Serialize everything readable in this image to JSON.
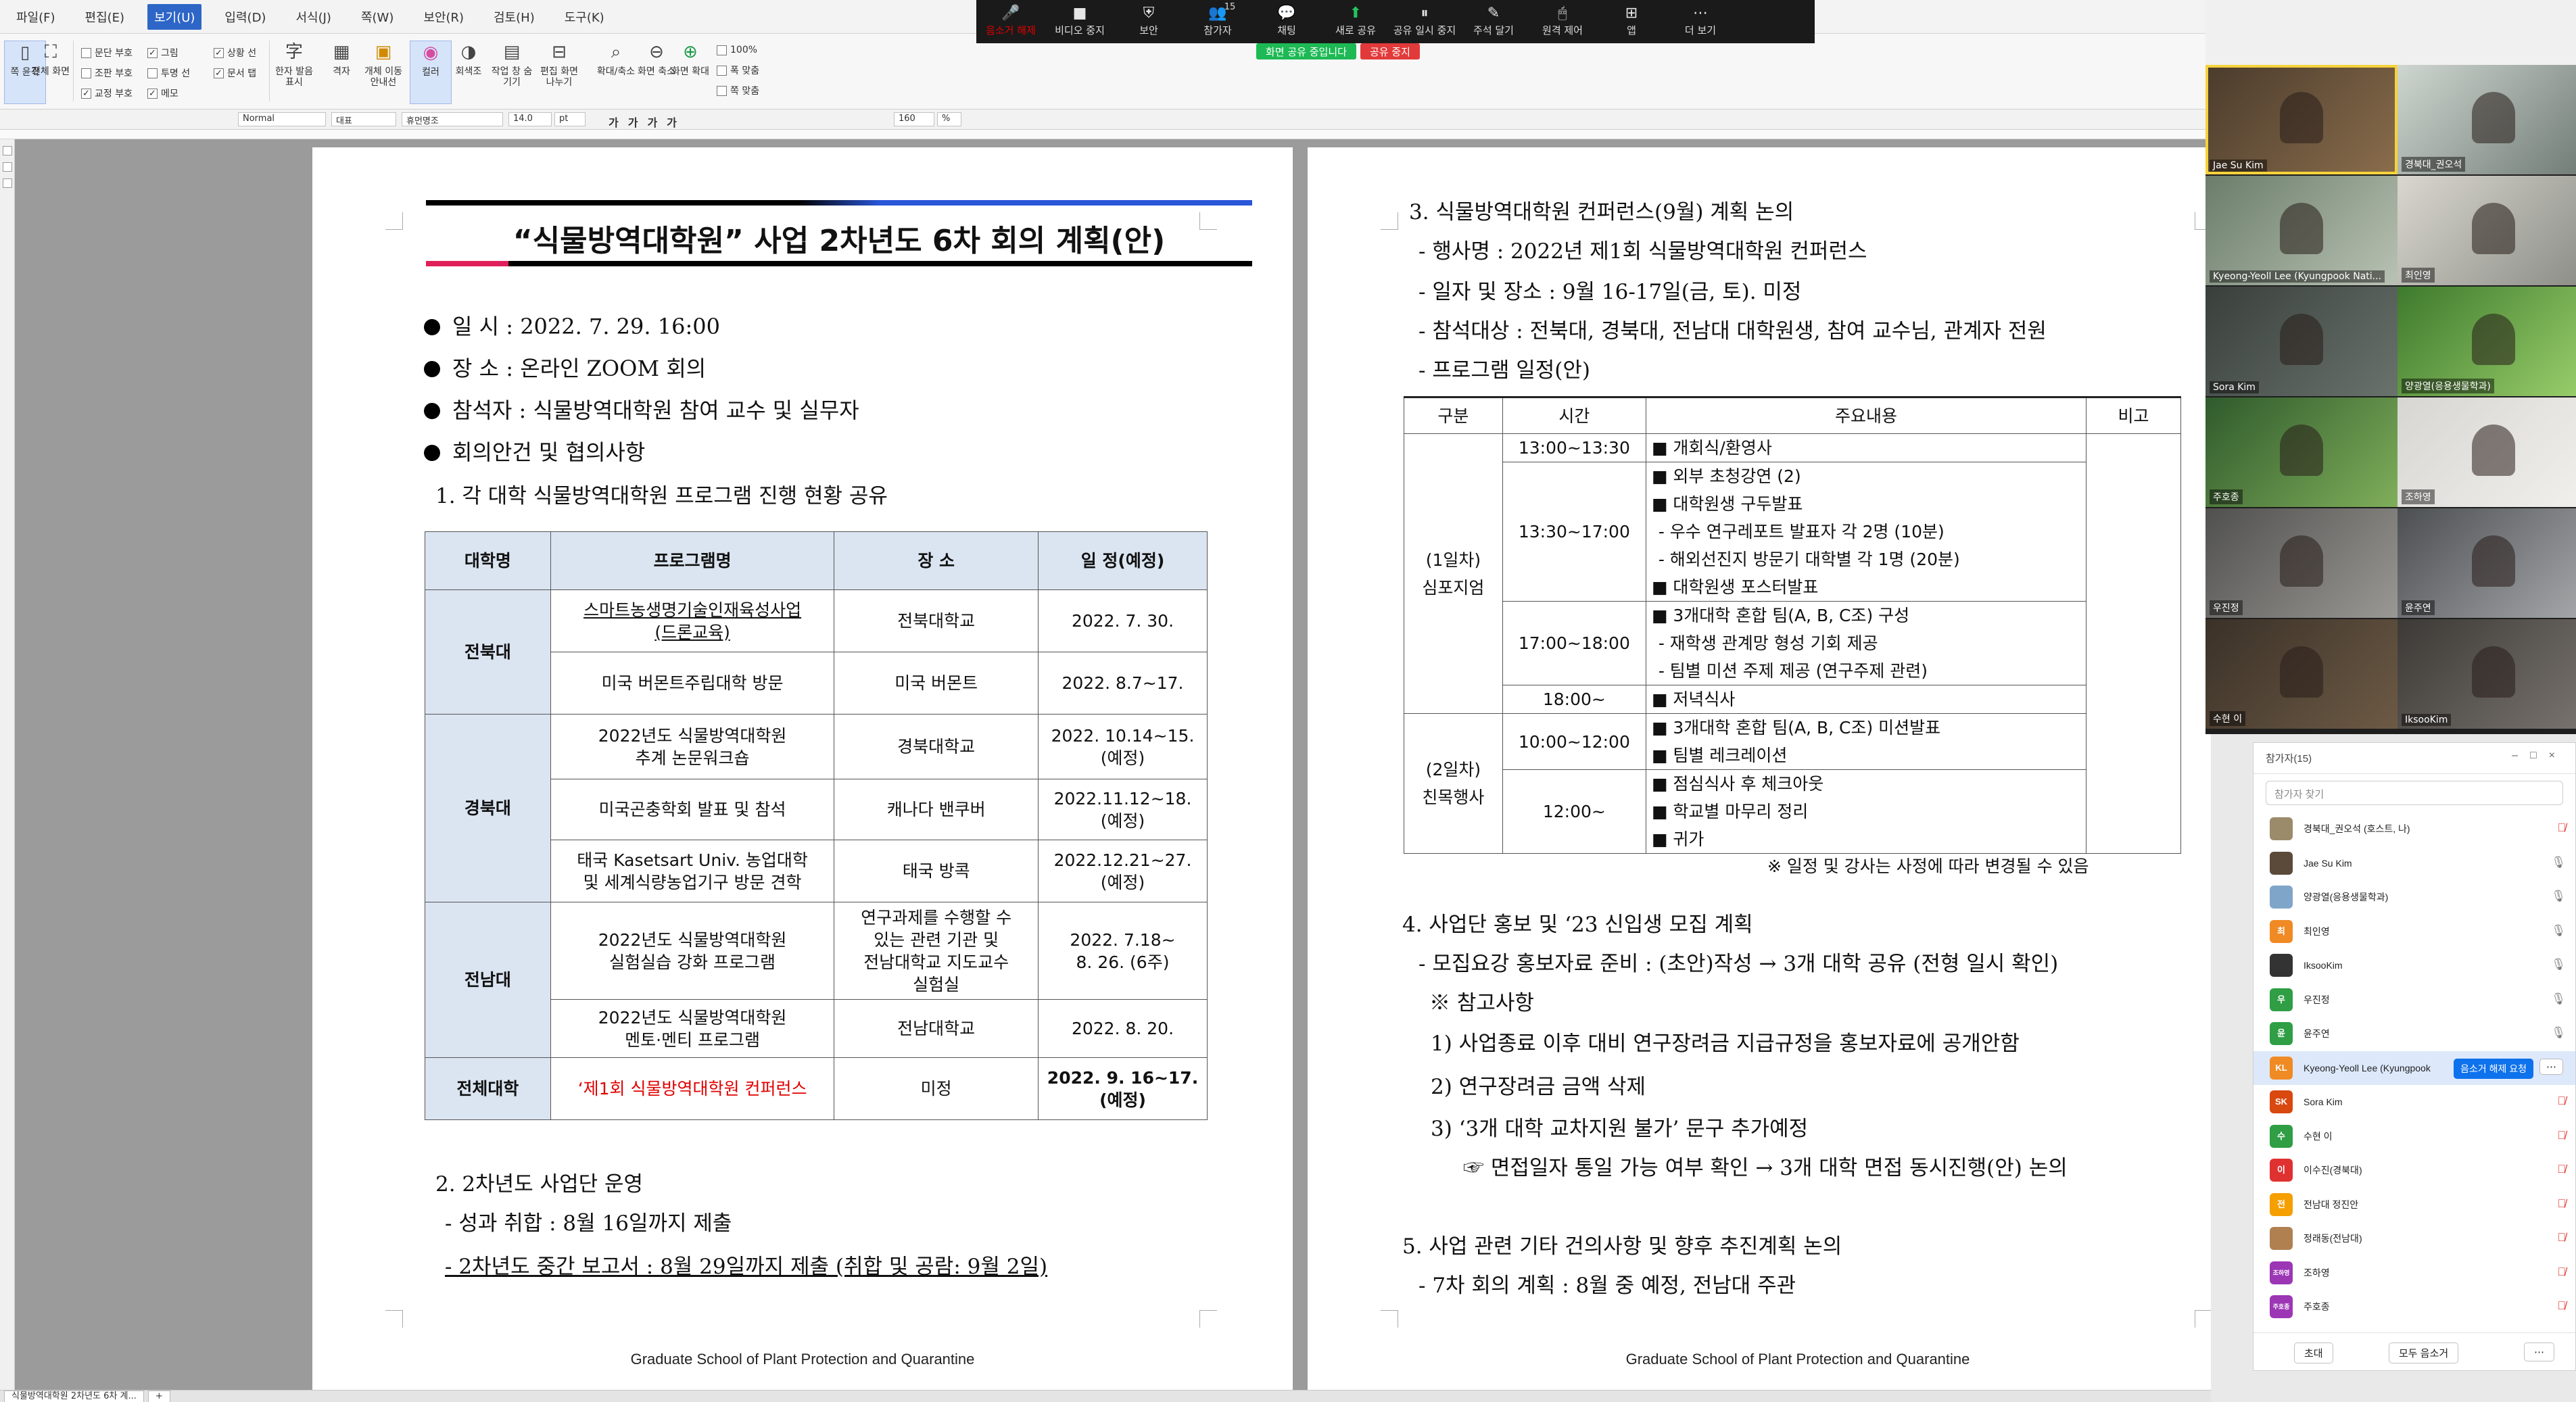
{
  "menu": [
    "파일(F)",
    "편집(E)",
    "보기(U)",
    "입력(D)",
    "서식(J)",
    "쪽(W)",
    "보안(R)",
    "검토(H)",
    "도구(K)"
  ],
  "menu_active_index": 2,
  "ribbon": {
    "left_buttons": [
      "쪽 윤곽",
      "전체 화면"
    ],
    "checks": [
      {
        "label": "문단 부호",
        "checked": false
      },
      {
        "label": "조판 부호",
        "checked": false
      },
      {
        "label": "교정 부호",
        "checked": true
      },
      {
        "label": "그림",
        "checked": true
      },
      {
        "label": "투명 선",
        "checked": false
      },
      {
        "label": "메모",
        "checked": true
      },
      {
        "label": "상황 선",
        "checked": true
      },
      {
        "label": "문서 탭",
        "checked": true
      }
    ],
    "buttons": [
      "한자 발음 표시",
      "격자",
      "개체 이동 안내선",
      "컬러",
      "회색조",
      "작업 창 숨기기",
      "편집 화면 나누기",
      "확대/축소",
      "화면 축소",
      "화면 확대"
    ],
    "zoom_options": [
      "100%",
      "폭 맞춤",
      "쪽 맞춤"
    ]
  },
  "format_bar": {
    "style": "Normal",
    "font_kind": "대표",
    "font": "휴먼명조",
    "size": "14.0",
    "unit": "pt",
    "line_spacing": "160",
    "spacing_unit": "%"
  },
  "status": {
    "tab": "식물방역대학원 2차년도 6차 계..."
  },
  "doc": {
    "footer": "Graduate School of Plant Protection and Quarantine",
    "title": "“식물방역대학원”  사업 2차년도 6차 회의 계획(안)",
    "meta": [
      {
        "label": "일    시",
        "value": " : 2022. 7. 29. 16:00"
      },
      {
        "label": "장    소",
        "value": " : 온라인 ZOOM 회의"
      },
      {
        "label": "참석자",
        "value": " : 식물방역대학원 참여 교수 및 실무자"
      },
      {
        "label": "회의안건 및 협의사항",
        "value": ""
      }
    ],
    "sec1": "1. 각 대학 식물방역대학원 프로그램 진행 현황 공유",
    "table1": {
      "headers": [
        "대학명",
        "프로그램명",
        "장 소",
        "일 정(예정)"
      ],
      "univ": [
        "전북대",
        "경북대",
        "전남대",
        "전체대학"
      ],
      "rows": [
        {
          "program": "스마트농생명기술인재육성사업\n(드론교육)",
          "place": "전북대학교",
          "date": "2022. 7. 30."
        },
        {
          "program": "미국 버몬트주립대학 방문",
          "place": "미국 버몬트",
          "date": "2022. 8.7~17."
        },
        {
          "program": "2022년도 식물방역대학원\n추계 논문워크숍",
          "place": "경북대학교",
          "date": "2022. 10.14~15.\n(예정)"
        },
        {
          "program": "미국곤충학회 발표 및 참석",
          "place": "캐나다 밴쿠버",
          "date": "2022.11.12~18.\n(예정)"
        },
        {
          "program": "태국 Kasetsart Univ. 농업대학\n및 세계식량농업기구 방문 견학",
          "place": "태국 방콕",
          "date": "2022.12.21~27.\n(예정)"
        },
        {
          "program": "2022년도 식물방역대학원\n실험실습 강화 프로그램",
          "place": "연구과제를 수행할 수\n있는 관련 기관 및\n전남대학교 지도교수\n실험실",
          "date": "2022. 7.18~\n8. 26. (6주)"
        },
        {
          "program": "2022년도 식물방역대학원\n멘토·멘티 프로그램",
          "place": "전남대학교",
          "date": "2022. 8. 20."
        },
        {
          "program": "‘제1회 식물방역대학원 컨퍼런스",
          "place": "미정",
          "date": "2022. 9. 16~17.\n(예정)"
        }
      ]
    },
    "sec2": {
      "title": "2. 2차년도 사업단 운영",
      "item1": "- 성과 취합 : 8월 16일까지 제출",
      "item2": "- 2차년도 중간 보고서 : 8월 29일까지 제출 (취합 및 공람: 9월 2일)"
    },
    "sec3": {
      "title": "3. 식물방역대학원 컨퍼런스(9월) 계획 논의",
      "items": [
        "- 행사명 : 2022년 제1회 식물방역대학원 컨퍼런스",
        "- 일자 및 장소 : 9월 16-17일(금, 토). 미정",
        "- 참석대상 : 전북대, 경북대, 전남대 대학원생, 참여 교수님, 관계자 전원",
        "- 프로그램 일정(안)"
      ]
    },
    "table2": {
      "headers": [
        "구분",
        "시간",
        "주요내용",
        "비고"
      ],
      "day1": "(1일차)\n심포지엄",
      "day2": "(2일차)\n친목행사",
      "rows": [
        {
          "time": "13:00~13:30",
          "items": [
            "■ 개회식/환영사"
          ]
        },
        {
          "time": "13:30~17:00",
          "items": [
            "■ 외부 초청강연 (2)",
            "■ 대학원생 구두발표",
            "- 우수 연구레포트 발표자 각 2명 (10분)",
            "- 해외선진지 방문기 대학별 각 1명 (20분)",
            "■ 대학원생 포스터발표"
          ]
        },
        {
          "time": "17:00~18:00",
          "items": [
            "■ 3개대학 혼합 팀(A, B, C조) 구성",
            "- 재학생 관계망 형성 기회 제공",
            "- 팀별 미션 주제 제공 (연구주제 관련)"
          ]
        },
        {
          "time": "18:00~",
          "items": [
            "■ 저녁식사"
          ]
        },
        {
          "time": "10:00~12:00",
          "items": [
            "■ 3개대학 혼합 팀(A, B, C조) 미션발표",
            "■ 팀별 레크레이션"
          ]
        },
        {
          "time": "12:00~",
          "items": [
            "■ 점심식사 후 체크아웃",
            "■ 학교별 마무리 정리",
            "■ 귀가"
          ]
        }
      ],
      "note": "※ 일정 및 강사는 사정에 따라 변경될 수 있음"
    },
    "sec4": {
      "title": "4. 사업단 홍보 및 ‘23 신입생 모집 계획",
      "item1": "- 모집요강 홍보자료 준비 : (초안)작성 → 3개 대학 공유 (전형 일시 확인)",
      "ref": "※ 참고사항",
      "r1": "1) 사업종료 이후 대비 연구장려금 지급규정을 홍보자료에 공개안함",
      "r2": "2) 연구장려금 금액 삭제",
      "r3": "3) ‘3개 대학 교차지원 불가’ 문구 추가예정",
      "r4": "☞ 면접일자 통일 가능 여부 확인 → 3개 대학 면접 동시진행(안) 논의"
    },
    "sec5": {
      "title": "5. 사업 관련 기타 건의사항 및 향후 추진계획 논의",
      "item1": "- 7차 회의 계획 : 8월 중 예정, 전남대 주관"
    }
  },
  "zoom": {
    "toolbar": [
      {
        "label": "음소거 해제",
        "icon": "mic-off-icon",
        "glyph": "🎤"
      },
      {
        "label": "비디오 중지",
        "icon": "video-icon",
        "glyph": "■"
      },
      {
        "label": "보안",
        "icon": "shield-icon",
        "glyph": "⛨"
      },
      {
        "label": "참가자",
        "icon": "participants-icon",
        "glyph": "👥"
      },
      {
        "label": "채팅",
        "icon": "chat-icon",
        "glyph": "💬"
      },
      {
        "label": "새로 공유",
        "icon": "share-icon",
        "glyph": "⬆"
      },
      {
        "label": "공유 일시 중지",
        "icon": "pause-icon",
        "glyph": "⏸"
      },
      {
        "label": "주석 달기",
        "icon": "annotate-icon",
        "glyph": "✎"
      },
      {
        "label": "원격 제어",
        "icon": "remote-icon",
        "glyph": "🖱"
      },
      {
        "label": "앱",
        "icon": "apps-icon",
        "glyph": "⊞"
      },
      {
        "label": "더 보기",
        "icon": "more-icon",
        "glyph": "⋯"
      }
    ],
    "participant_count": "15",
    "share_status": "화면 공유 중입니다",
    "stop_share": "공유 중지",
    "gallery_names": [
      "Jae Su Kim",
      "경북대_권오석",
      "Kyeong-Yeoll Lee (Kyungpook Nati...",
      "최인영",
      "Sora Kim",
      "양광열(응용생물학과)",
      "주호종",
      "조하영",
      "우진정",
      "윤주연",
      "수현 이",
      "IksooKim"
    ],
    "panel": {
      "title": "참가자(15)",
      "search_placeholder": "참가자 찾기",
      "unmute_request": "음소거 해제 요청",
      "invite": "초대",
      "mute_all": "모두 음소거",
      "participants": [
        {
          "name": "경북대_권오석 (호스트, 나)",
          "initials": "",
          "color": "#9b8b6a",
          "mic": "off"
        },
        {
          "name": "Jae Su Kim",
          "initials": "",
          "color": "#5b4a3a",
          "mic": "on"
        },
        {
          "name": "양광열(응용생물학과)",
          "initials": "",
          "color": "#7fa6c9",
          "mic": "on"
        },
        {
          "name": "최인영",
          "initials": "최",
          "color": "#f08a24",
          "mic": "on"
        },
        {
          "name": "IksooKim",
          "initials": "",
          "color": "#333333",
          "mic": "on"
        },
        {
          "name": "우진정",
          "initials": "우",
          "color": "#2f9e44",
          "mic": "on"
        },
        {
          "name": "윤주연",
          "initials": "윤",
          "color": "#2f9e44",
          "mic": "on"
        },
        {
          "name": "Kyeong-Yeoll Lee (Kyungpook",
          "initials": "KL",
          "color": "#f08a24",
          "mic": "on"
        },
        {
          "name": "Sora Kim",
          "initials": "SK",
          "color": "#d9480f",
          "mic": "off"
        },
        {
          "name": "수현 이",
          "initials": "수",
          "color": "#2f9e44",
          "mic": "off"
        },
        {
          "name": "이수진(경북대)",
          "initials": "이",
          "color": "#e03131",
          "mic": "off"
        },
        {
          "name": "전남대 정진안",
          "initials": "전",
          "color": "#f59f00",
          "mic": "off"
        },
        {
          "name": "정래동(전남대)",
          "initials": "",
          "color": "#b08050",
          "mic": "off"
        },
        {
          "name": "조하영",
          "initials": "조하영",
          "color": "#9c36b5",
          "mic": "off"
        },
        {
          "name": "주호종",
          "initials": "주호종",
          "color": "#9c36b5",
          "mic": "off"
        }
      ]
    }
  },
  "colors": {
    "accent": "#2e66c7",
    "zoom_blue": "#0e72ed",
    "table_header": "#dbe5f1",
    "red_text": "#e00000"
  }
}
